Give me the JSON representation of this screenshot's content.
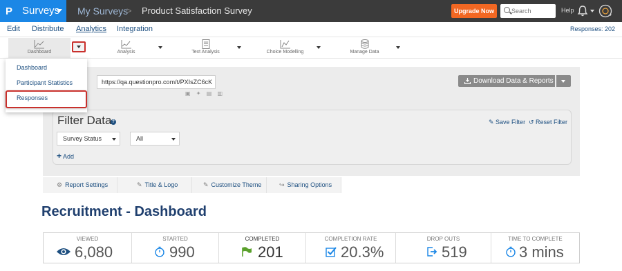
{
  "topbar": {
    "logo": "P",
    "app_name": "Surveys",
    "breadcrumb_1": "My Surveys",
    "breadcrumb_sep": ">",
    "breadcrumb_2": "Product Satisfaction Survey",
    "upgrade_label": "Upgrade Now",
    "search_placeholder": "Search",
    "help_label": "Help",
    "accent_color": "#1b87e6",
    "upgrade_color": "#f26722"
  },
  "nav": {
    "items": [
      {
        "label": "Edit"
      },
      {
        "label": "Distribute"
      },
      {
        "label": "Analytics"
      },
      {
        "label": "Integration"
      }
    ],
    "responses": "Responses: 202"
  },
  "toolbar": {
    "items": [
      {
        "label": "Dashboard",
        "icon": "line-chart-icon"
      },
      {
        "label": "Analysis",
        "icon": "analysis-chart-icon"
      },
      {
        "label": "Text Analysis",
        "icon": "text-document-icon"
      },
      {
        "label": "Choice Modelling",
        "icon": "choice-chart-icon"
      },
      {
        "label": "Manage Data",
        "icon": "database-icon"
      }
    ]
  },
  "dropdown_menu": {
    "items": [
      {
        "label": "Dashboard"
      },
      {
        "label": "Participant Statistics"
      },
      {
        "label": "Responses"
      }
    ]
  },
  "weblink": {
    "label": "k",
    "url": "https://qa.questionpro.com/t/PXIsZC6cK",
    "download_label": "Download Data & Reports"
  },
  "filter": {
    "title": "Filter Data",
    "help": "?",
    "save_label": "Save Filter",
    "reset_label": "Reset Filter",
    "select_1": "Survey Status",
    "select_2": "All",
    "add_label": "Add"
  },
  "tabs": [
    {
      "label": "Report Settings",
      "icon": "gears-icon"
    },
    {
      "label": "Title & Logo",
      "icon": "pencil-icon"
    },
    {
      "label": "Customize Theme",
      "icon": "pencil-icon"
    },
    {
      "label": "Sharing Options",
      "icon": "share-icon"
    }
  ],
  "dashboard": {
    "title": "Recruitment - Dashboard",
    "stats": [
      {
        "label": "VIEWED",
        "value": "6,080",
        "icon": "eye-icon",
        "color": "#1d4f80"
      },
      {
        "label": "STARTED",
        "value": "990",
        "icon": "stopwatch-icon",
        "color": "#1b87e6"
      },
      {
        "label": "COMPLETED",
        "value": "201",
        "icon": "flag-icon",
        "color": "#5aa02c"
      },
      {
        "label": "COMPLETION RATE",
        "value": "20.3%",
        "icon": "checkbox-icon",
        "color": "#1b87e6"
      },
      {
        "label": "DROP OUTS",
        "value": "519",
        "icon": "exit-icon",
        "color": "#1b87e6"
      },
      {
        "label": "TIME TO COMPLETE",
        "value": "3 mins",
        "icon": "stopwatch-icon",
        "color": "#1b87e6"
      }
    ]
  }
}
